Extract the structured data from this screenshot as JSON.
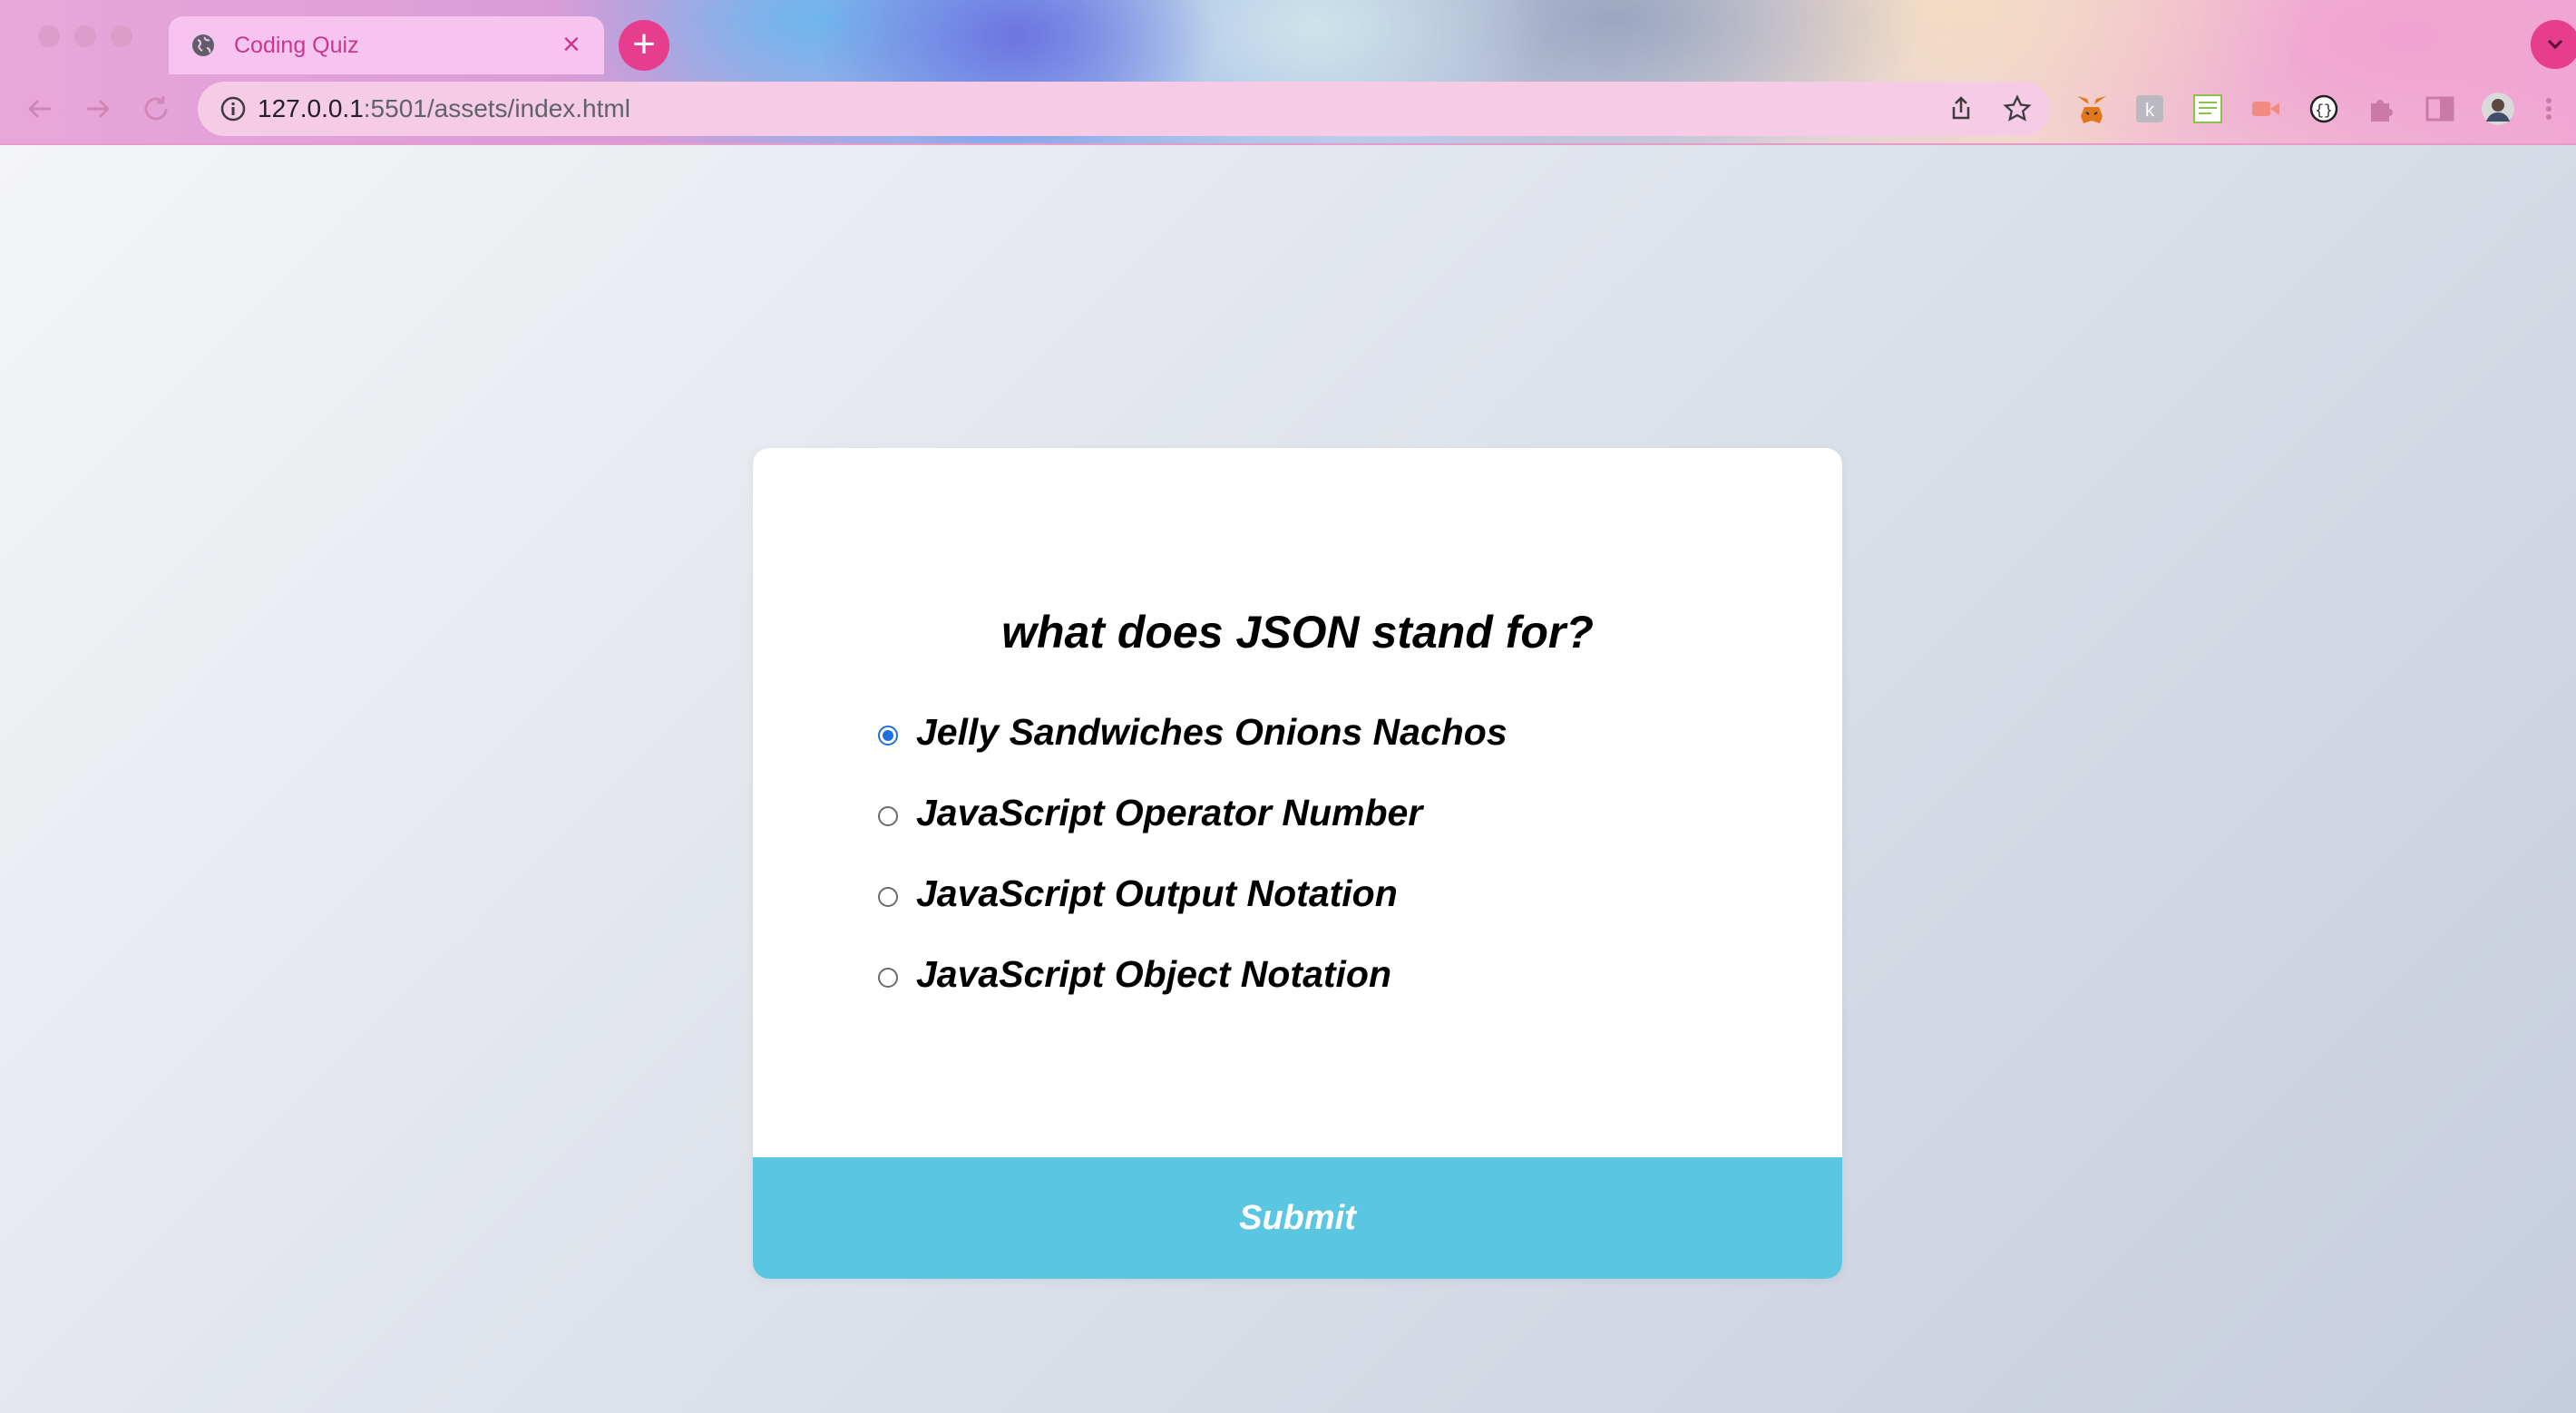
{
  "browser": {
    "tab_title": "Coding Quiz",
    "url_host": "127.0.0.1",
    "url_rest": ":5501/assets/index.html",
    "icons": [
      "globe-icon",
      "close-icon",
      "plus-icon",
      "chevron-down-icon",
      "back-icon",
      "forward-icon",
      "reload-icon",
      "info-icon",
      "share-icon",
      "star-icon",
      "metamask-icon",
      "extension-icon",
      "puzzle-icon",
      "sidebar-icon",
      "avatar"
    ]
  },
  "quiz": {
    "question": "what does JSON stand for?",
    "answers": [
      {
        "label": "Jelly Sandwiches Onions Nachos",
        "checked": true
      },
      {
        "label": "JavaScript Operator Number",
        "checked": false
      },
      {
        "label": "JavaScript Output Notation",
        "checked": false
      },
      {
        "label": "JavaScript Object Notation",
        "checked": false
      }
    ],
    "submit_label": "Submit"
  },
  "colors": {
    "accent_pink": "#e73d8e",
    "submit_bg": "#5bc6e2",
    "radio_checked": "#1f6fe0"
  }
}
